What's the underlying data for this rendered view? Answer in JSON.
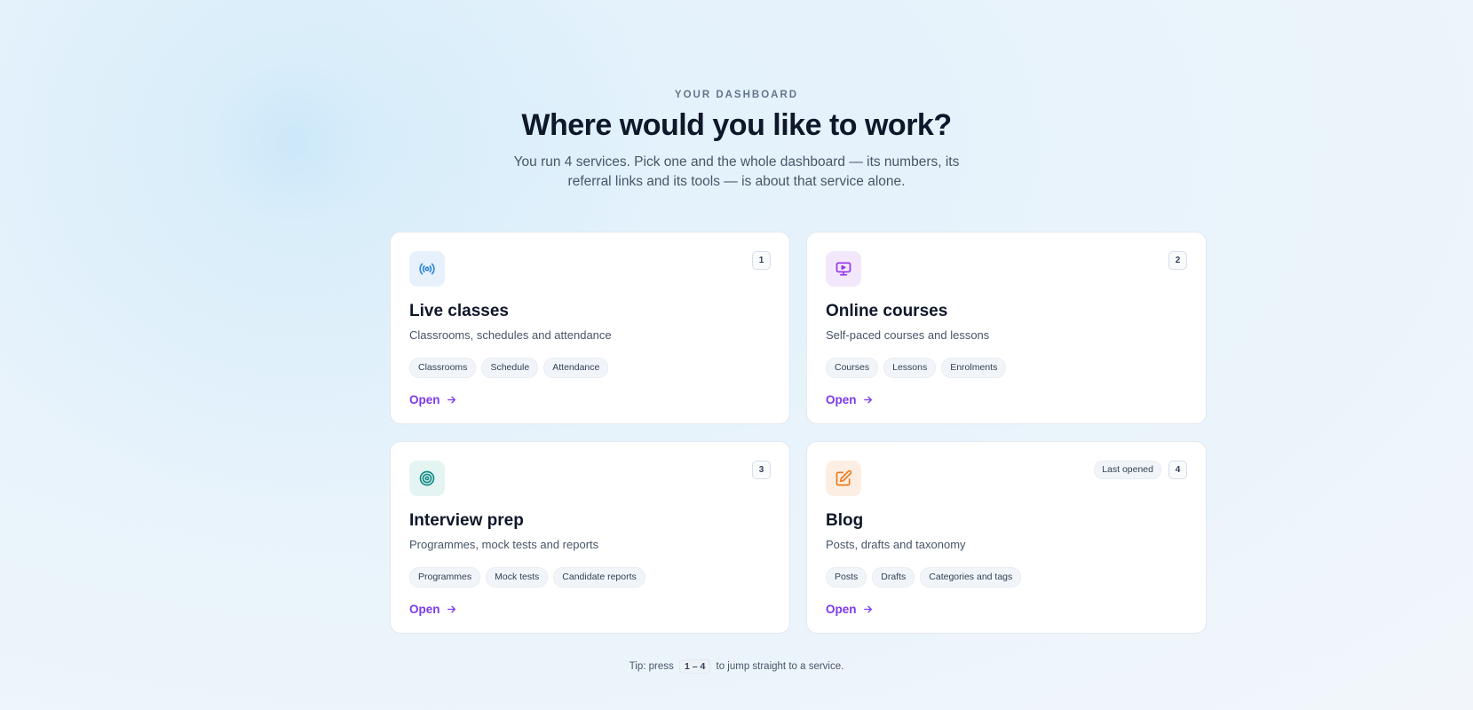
{
  "header": {
    "eyebrow": "YOUR DASHBOARD",
    "title": "Where would you like to work?",
    "subtitle": "You run 4 services. Pick one and the whole dashboard — its numbers, its referral links and its tools — is about that service alone."
  },
  "cards": [
    {
      "number": "1",
      "title": "Live classes",
      "description": "Classrooms, schedules and attendance",
      "tags": [
        "Classrooms",
        "Schedule",
        "Attendance"
      ],
      "open_label": "Open",
      "icon": "broadcast-icon",
      "icon_bg": "#e7f1fc",
      "icon_color": "#2f86d8"
    },
    {
      "number": "2",
      "title": "Online courses",
      "description": "Self-paced courses and lessons",
      "tags": [
        "Courses",
        "Lessons",
        "Enrolments"
      ],
      "open_label": "Open",
      "icon": "monitor-play-icon",
      "icon_bg": "#f3e8fb",
      "icon_color": "#9333ea"
    },
    {
      "number": "3",
      "title": "Interview prep",
      "description": "Programmes, mock tests and reports",
      "tags": [
        "Programmes",
        "Mock tests",
        "Candidate reports"
      ],
      "open_label": "Open",
      "icon": "target-icon",
      "icon_bg": "#e4f4f3",
      "icon_color": "#0f8a84"
    },
    {
      "number": "4",
      "last_opened": "Last opened",
      "title": "Blog",
      "description": "Posts, drafts and taxonomy",
      "tags": [
        "Posts",
        "Drafts",
        "Categories and tags"
      ],
      "open_label": "Open",
      "icon": "edit-icon",
      "icon_bg": "#fdeee3",
      "icon_color": "#ea7a1c"
    }
  ],
  "tip": {
    "prefix": "Tip: press",
    "keys": "1 – 4",
    "suffix": "to jump straight to a service."
  },
  "colors": {
    "accent": "#7c3aed",
    "title": "#0f172a",
    "muted": "#475569"
  }
}
